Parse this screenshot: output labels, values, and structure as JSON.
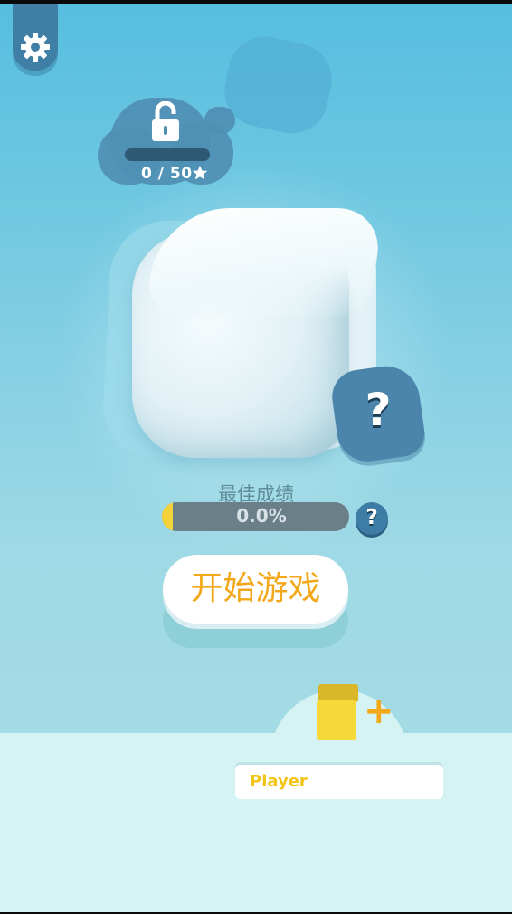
{
  "colors": {
    "sky_top": "#56bedf",
    "sky_bottom": "#a6dde4",
    "accent_orange": "#f2a818",
    "player_yellow": "#f6d838",
    "button_blue": "#3f7fa5"
  },
  "settings": {
    "icon": "gear-icon"
  },
  "unlock": {
    "icon": "lock-open-icon",
    "star_count": "0 / 50",
    "star_icon": "star-icon",
    "progress": 0.0
  },
  "character": {
    "mystery_label": "?"
  },
  "best_score": {
    "label": "最佳成绩",
    "value_text": "0.0%",
    "progress": 0.0,
    "help_label": "?"
  },
  "start_button": {
    "label": "开始游戏"
  },
  "player": {
    "add_icon": "plus-icon",
    "name_value": "Player"
  }
}
